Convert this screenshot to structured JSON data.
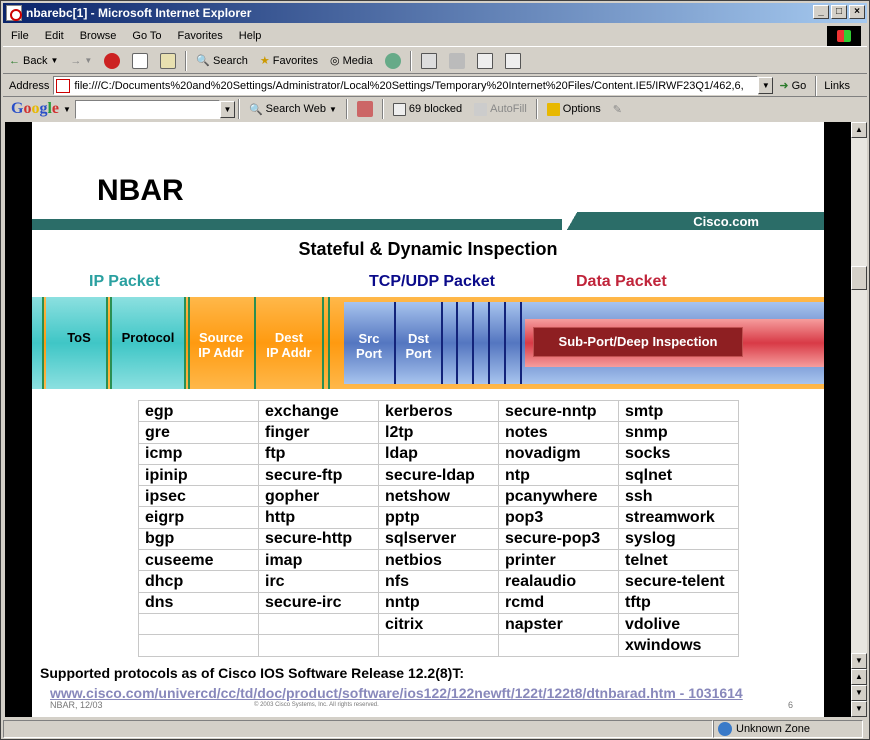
{
  "window": {
    "title": "nbarebc[1] - Microsoft Internet Explorer",
    "minimize": "_",
    "maximize": "□",
    "close": "×"
  },
  "menu": [
    "File",
    "Edit",
    "Browse",
    "Go To",
    "Favorites",
    "Help"
  ],
  "toolbar": {
    "back": "Back",
    "search": "Search",
    "favorites": "Favorites",
    "media": "Media"
  },
  "address": {
    "label": "Address",
    "url": "file:///C:/Documents%20and%20Settings/Administrator/Local%20Settings/Temporary%20Internet%20Files/Content.IE5/IRWF23Q1/462,6,",
    "go": "Go",
    "links": "Links"
  },
  "googlebar": {
    "logo": "Google",
    "search_web": "Search Web",
    "blocked": "69 blocked",
    "autofill": "AutoFill",
    "options": "Options"
  },
  "slide": {
    "title": "NBAR",
    "brand": "Cisco.com",
    "subtitle": "Stateful & Dynamic Inspection",
    "labels": {
      "ip": "IP Packet",
      "tcp": "TCP/UDP Packet",
      "data": "Data Packet"
    },
    "fields": {
      "tos": "ToS",
      "protocol": "Protocol",
      "source_ip": "Source\nIP Addr",
      "dest_ip": "Dest\nIP Addr",
      "src_port": "Src\nPort",
      "dst_port": "Dst\nPort",
      "subport": "Sub-Port/Deep Inspection"
    },
    "label_colors": {
      "ip": "#2aa0a0",
      "tcp": "#0a0a8a",
      "data": "#c0243a"
    },
    "protocols": [
      [
        "egp",
        "exchange",
        "kerberos",
        "secure-nntp",
        "smtp"
      ],
      [
        "gre",
        "finger",
        "l2tp",
        "notes",
        "snmp"
      ],
      [
        "icmp",
        "ftp",
        "ldap",
        "novadigm",
        "socks"
      ],
      [
        "ipinip",
        "secure-ftp",
        "secure-ldap",
        "ntp",
        "sqlnet"
      ],
      [
        "ipsec",
        "gopher",
        "netshow",
        "pcanywhere",
        "ssh"
      ],
      [
        "eigrp",
        "http",
        "pptp",
        "pop3",
        "streamwork"
      ],
      [
        "bgp",
        "secure-http",
        "sqlserver",
        "secure-pop3",
        "syslog"
      ],
      [
        "cuseeme",
        "imap",
        "netbios",
        "printer",
        "telnet"
      ],
      [
        "dhcp",
        "irc",
        "nfs",
        "realaudio",
        "secure-telent"
      ],
      [
        "dns",
        "secure-irc",
        "nntp",
        "rcmd",
        "tftp"
      ],
      [
        "",
        "",
        "citrix",
        "napster",
        "vdolive"
      ],
      [
        "",
        "",
        "",
        "",
        "xwindows"
      ]
    ],
    "footnote": "Supported protocols as of Cisco IOS Software Release 12.2(8)T:",
    "url": "www.cisco.com/univercd/cc/td/doc/product/software/ios122/122newft/122t/122t8/dtnbarad.htm - 1031614",
    "footer_left": "NBAR, 12/03",
    "footer_mid": "© 2003 Cisco Systems, Inc. All rights reserved.",
    "footer_right": "6"
  },
  "status": {
    "zone": "Unknown Zone"
  }
}
